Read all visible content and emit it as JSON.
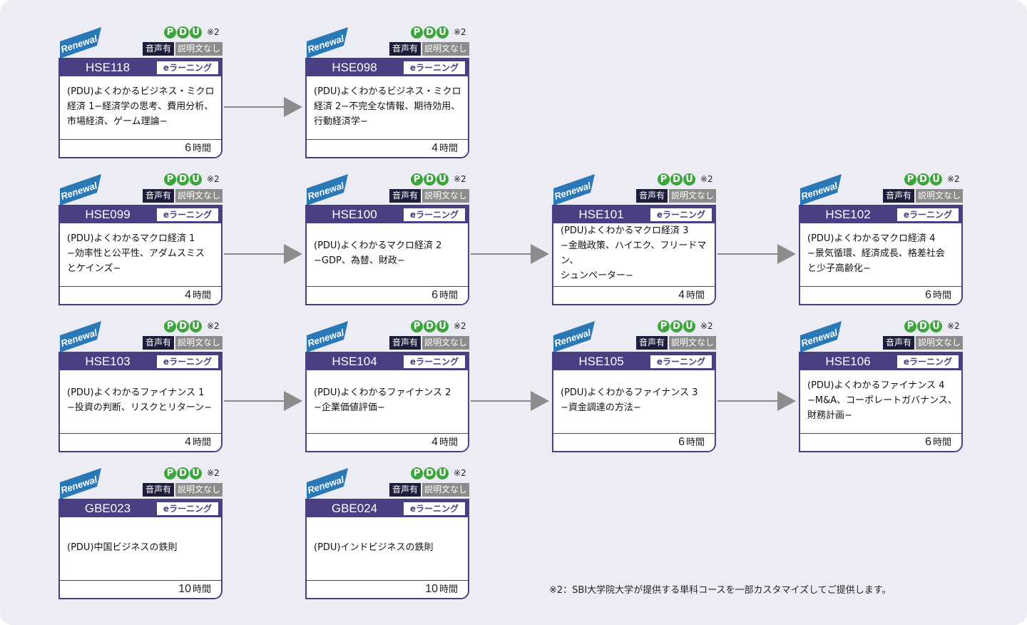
{
  "labels": {
    "renewal": "Renewal",
    "pdu_letters": [
      "P",
      "D",
      "U"
    ],
    "pdu_note": "※2",
    "sound": "音声有",
    "no_description": "説明文なし",
    "type": "eラーニング",
    "hour_unit": "時間"
  },
  "courses": [
    {
      "code": "HSE118",
      "title_lines": [
        "(PDU)よくわかるビジネス・ミクロ",
        "経済 1−経済学の思考、費用分析、",
        "市場経済、ゲーム理論−"
      ],
      "hours": "6"
    },
    {
      "code": "HSE098",
      "title_lines": [
        "(PDU)よくわかるビジネス・ミクロ",
        "経済 2−不完全な情報、期待効用、",
        "行動経済学−"
      ],
      "hours": "4"
    },
    {
      "code": "HSE099",
      "title_lines": [
        "(PDU)よくわかるマクロ経済 1",
        "−効率性と公平性、アダムスミス",
        "とケインズ−"
      ],
      "hours": "4"
    },
    {
      "code": "HSE100",
      "title_lines": [
        "(PDU)よくわかるマクロ経済 2",
        "−GDP、為替、財政−"
      ],
      "hours": "6"
    },
    {
      "code": "HSE101",
      "title_lines": [
        "(PDU)よくわかるマクロ経済 3",
        "−金融政策、ハイエク、フリードマン、",
        "シュンペーター−"
      ],
      "hours": "4"
    },
    {
      "code": "HSE102",
      "title_lines": [
        "(PDU)よくわかるマクロ経済 4",
        "−景気循環、経済成長、格差社会",
        "と少子高齢化−"
      ],
      "hours": "6"
    },
    {
      "code": "HSE103",
      "title_lines": [
        "(PDU)よくわかるファイナンス 1",
        "−投資の判断、リスクとリターン−"
      ],
      "hours": "4"
    },
    {
      "code": "HSE104",
      "title_lines": [
        "(PDU)よくわかるファイナンス 2",
        "−企業価値評価−"
      ],
      "hours": "4"
    },
    {
      "code": "HSE105",
      "title_lines": [
        "(PDU)よくわかるファイナンス 3",
        "−資金調達の方法−"
      ],
      "hours": "6"
    },
    {
      "code": "HSE106",
      "title_lines": [
        "(PDU)よくわかるファイナンス 4",
        "−M&A、コーポレートガバナンス、",
        "財務計画−"
      ],
      "hours": "6"
    },
    {
      "code": "GBE023",
      "title_lines": [
        "(PDU)中国ビジネスの鉄則"
      ],
      "hours": "10"
    },
    {
      "code": "GBE024",
      "title_lines": [
        "(PDU)インドビジネスの鉄則"
      ],
      "hours": "10"
    }
  ],
  "footnote": "※2：SBI大学院大学が提供する単科コースを一部カスタマイズしてご提供します。",
  "colors": {
    "card_border": "#4a3f82",
    "pdu_green": "#3ca53c",
    "renewal_blue": "#2a78b5",
    "badge_dark": "#1e1e3c",
    "badge_gray": "#8c8c8c",
    "arrow": "#8c8c8c",
    "panel": "#ececf5"
  }
}
